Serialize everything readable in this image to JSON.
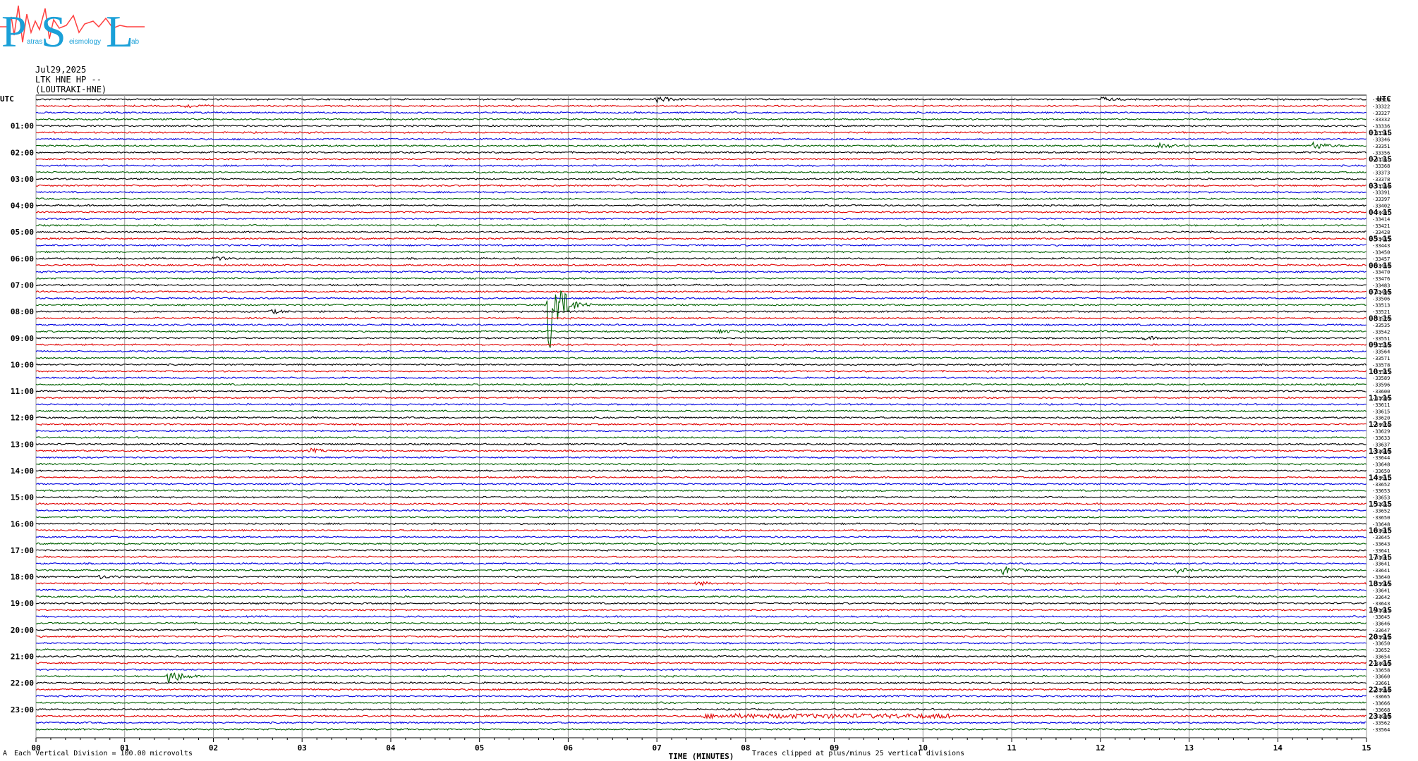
{
  "header": {
    "date": "Jul29,2025",
    "station": "LTK HNE HP --",
    "location": "(LOUTRAKI-HNE)"
  },
  "logo": {
    "letters": [
      "P",
      "S",
      "L"
    ],
    "small_text": [
      "atras",
      "eismology",
      "ab"
    ]
  },
  "footer": {
    "scale_note": "Each Vertical Division = 100.00 microvolts",
    "clip_note": "Traces clipped at plus/minus 25 vertical divisions",
    "corner_mark": "A"
  },
  "colors": {
    "trace_cycle": [
      "#000000",
      "#e00000",
      "#0000e0",
      "#006000"
    ],
    "grid": "#9a9a9a",
    "logo_main": "#1aa0d8",
    "logo_wave": "#ff4040"
  },
  "chart_data": {
    "type": "helicorder",
    "xlabel": "TIME (MINUTES)",
    "xlim": [
      0,
      15
    ],
    "x_ticks": [
      "00",
      "01",
      "02",
      "03",
      "04",
      "05",
      "06",
      "07",
      "08",
      "09",
      "10",
      "11",
      "12",
      "13",
      "14",
      "15"
    ],
    "left_axis_title": "UTC",
    "right_axis_title": "UTC",
    "rows_per_hour": 4,
    "row_count": 96,
    "left_labels": [
      "01:00",
      "02:00",
      "03:00",
      "04:00",
      "05:00",
      "06:00",
      "07:00",
      "08:00",
      "09:00",
      "10:00",
      "11:00",
      "12:00",
      "13:00",
      "14:00",
      "15:00",
      "16:00",
      "17:00",
      "18:00",
      "19:00",
      "20:00",
      "21:00",
      "22:00",
      "23:00"
    ],
    "right_labels": [
      "01:15",
      "02:15",
      "03:15",
      "04:15",
      "05:15",
      "06:15",
      "07:15",
      "08:15",
      "09:15",
      "10:15",
      "11:15",
      "12:15",
      "13:15",
      "14:15",
      "15:15",
      "16:15",
      "17:15",
      "18:15",
      "19:15",
      "20:15",
      "21:15",
      "22:15",
      "23:15"
    ],
    "row_offsets": [
      "-33318",
      "-33322",
      "-33327",
      "-33332",
      "-33336",
      "-33341",
      "-33346",
      "-33351",
      "-33356",
      "-33362",
      "-33368",
      "-33373",
      "-33378",
      "-33384",
      "-33391",
      "-33397",
      "-33402",
      "-33407",
      "-33414",
      "-33421",
      "-33428",
      "-33435",
      "-33443",
      "-33450",
      "-33457",
      "-33464",
      "-33470",
      "-33476",
      "-33483",
      "-33490",
      "-33506",
      "-33513",
      "-33521",
      "-33528",
      "-33535",
      "-33542",
      "-33551",
      "-33558",
      "-33564",
      "-33571",
      "-33578",
      "-33583",
      "-33589",
      "-33596",
      "-33600",
      "-33606",
      "-33611",
      "-33615",
      "-33620",
      "-33624",
      "-33629",
      "-33633",
      "-33637",
      "-33640",
      "-33644",
      "-33648",
      "-33650",
      "-33651",
      "-33652",
      "-33653",
      "-33653",
      "-33652",
      "-33652",
      "-33650",
      "-33648",
      "-33647",
      "-33645",
      "-33643",
      "-33641",
      "-33641",
      "-33641",
      "-33641",
      "-33640",
      "-33640",
      "-33641",
      "-33642",
      "-33643",
      "-33643",
      "-33645",
      "-33646",
      "-33647",
      "-33649",
      "-33650",
      "-33652",
      "-33654",
      "-33656",
      "-33658",
      "-33660",
      "-33661",
      "-33664",
      "-33665",
      "-33666",
      "-33668",
      "-33600",
      "-33562",
      "-33564"
    ],
    "events": [
      {
        "row": 0,
        "minute": 7.0,
        "amplitude": 0.3
      },
      {
        "row": 0,
        "minute": 12.0,
        "amplitude": 0.25
      },
      {
        "row": 1,
        "minute": 1.7,
        "amplitude": 0.2
      },
      {
        "row": 7,
        "minute": 12.65,
        "amplitude": 0.35
      },
      {
        "row": 7,
        "minute": 14.4,
        "amplitude": 0.45
      },
      {
        "row": 24,
        "minute": 2.0,
        "amplitude": 0.2
      },
      {
        "row": 31,
        "minute": 5.78,
        "amplitude": 6.0
      },
      {
        "row": 32,
        "minute": 2.65,
        "amplitude": 0.2
      },
      {
        "row": 35,
        "minute": 7.7,
        "amplitude": 0.2
      },
      {
        "row": 36,
        "minute": 12.5,
        "amplitude": 0.18
      },
      {
        "row": 53,
        "minute": 3.1,
        "amplitude": 0.2
      },
      {
        "row": 71,
        "minute": 10.9,
        "amplitude": 0.45
      },
      {
        "row": 71,
        "minute": 12.85,
        "amplitude": 0.3
      },
      {
        "row": 72,
        "minute": 0.7,
        "amplitude": 0.2
      },
      {
        "row": 73,
        "minute": 7.45,
        "amplitude": 0.2
      },
      {
        "row": 87,
        "minute": 1.5,
        "amplitude": 0.9
      }
    ],
    "noise_band": {
      "row": 93,
      "minute_start": 7.5,
      "minute_end": 10.3
    }
  }
}
